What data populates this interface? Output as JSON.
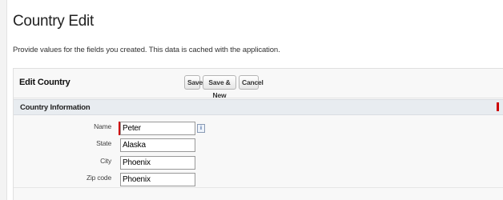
{
  "page": {
    "title": "Country Edit",
    "description": "Provide values for the fields you created. This data is cached with the application."
  },
  "panel": {
    "title": "Edit Country",
    "buttons": {
      "save": "Save",
      "save_new": "Save & New",
      "cancel": "Cancel"
    }
  },
  "section": {
    "title": "Country Information"
  },
  "fields": [
    {
      "label": "Name",
      "value": "Peter",
      "required": true
    },
    {
      "label": "State",
      "value": "Alaska",
      "required": false
    },
    {
      "label": "City",
      "value": "Phoenix",
      "required": false
    },
    {
      "label": "Zip code",
      "value": "Phoenix",
      "required": false
    }
  ],
  "icons": {
    "info": "i"
  },
  "colors": {
    "required": "#cc0000",
    "section_header": "#e8ecf0"
  }
}
